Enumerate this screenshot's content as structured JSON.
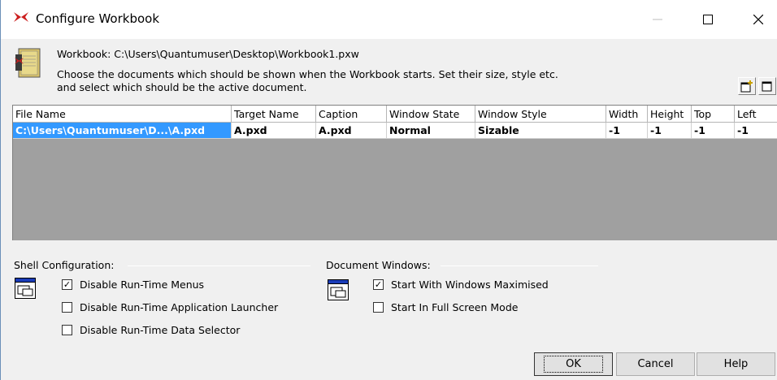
{
  "window": {
    "title": "Configure Workbook",
    "colors": {
      "title_icon": "#cc1f1f",
      "selection": "#3399ff",
      "grid_bg": "#a0a0a0"
    }
  },
  "header": {
    "workbook_label": "Workbook:  C:\\Users\\Quantumuser\\Desktop\\Workbook1.pxw",
    "description": "Choose the documents which should be shown when the Workbook starts.  Set their size, style etc. and select which should be the active document."
  },
  "toolbar": {
    "icons": [
      "add-document-icon",
      "document-properties-icon"
    ]
  },
  "grid": {
    "columns": [
      "File Name",
      "Target Name",
      "Caption",
      "Window State",
      "Window Style",
      "Width",
      "Height",
      "Top",
      "Left"
    ],
    "rows": [
      [
        "C:\\Users\\Quantumuser\\D...\\A.pxd",
        "A.pxd",
        "A.pxd",
        "Normal",
        "Sizable",
        "-1",
        "-1",
        "-1",
        "-1"
      ]
    ]
  },
  "shell": {
    "label": "Shell Configuration:",
    "options": [
      {
        "label": "Disable Run-Time Menus",
        "checked": true
      },
      {
        "label": "Disable Run-Time Application Launcher",
        "checked": false
      },
      {
        "label": "Disable Run-Time Data Selector",
        "checked": false
      }
    ]
  },
  "docwin": {
    "label": "Document Windows:",
    "options": [
      {
        "label": "Start With Windows Maximised",
        "checked": true
      },
      {
        "label": "Start In Full Screen Mode",
        "checked": false
      }
    ]
  },
  "buttons": {
    "ok": "OK",
    "cancel": "Cancel",
    "help": "Help"
  },
  "caption_buttons": {
    "minimize": "—",
    "maximize": "☐",
    "close": "✕"
  }
}
